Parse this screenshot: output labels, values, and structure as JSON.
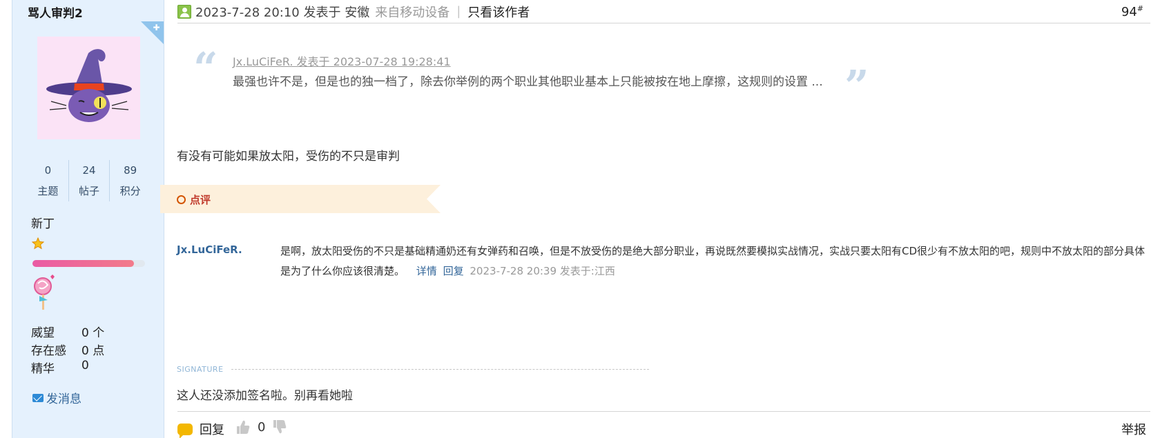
{
  "author": {
    "name": "骂人审判2",
    "stats": [
      {
        "value": "0",
        "label": "主题"
      },
      {
        "value": "24",
        "label": "帖子"
      },
      {
        "value": "89",
        "label": "积分"
      }
    ],
    "rank": "新丁",
    "rank_progress_percent": 90,
    "info": [
      {
        "label": "威望",
        "value": "0 个"
      },
      {
        "label": "存在感",
        "value": "0 点"
      },
      {
        "label": "精华",
        "value": "0"
      }
    ],
    "send_message": "发消息"
  },
  "post": {
    "time": "2023-7-28 20:10 发表于 安徽",
    "from": "来自移动设备",
    "separator": "|",
    "only_author": "只看该作者",
    "floor_number": "94",
    "floor_suffix": "#"
  },
  "quote": {
    "author_line": "Jx.LuCiFeR. 发表于 2023-07-28 19:28:41",
    "text": "最强也许不是，但是也的独一档了，除去你举例的两个职业其他职业基本上只能被按在地上摩擦，这规则的设置 ...",
    "open_mark": "“",
    "close_mark": "”"
  },
  "message": "有没有可能如果放太阳，受伤的不只是审判",
  "comments": {
    "section_label": "点评",
    "items": [
      {
        "user": "Jx.LuCiFeR.",
        "text": "是啊，放太阳受伤的不只是基础精通奶还有女弹药和召唤，但是不放受伤的是绝大部分职业，再说既然要模拟实战情况，实战只要太阳有CD很少有不放太阳的吧，规则中不放太阳的部分具体是为了什么你应该很清楚。",
        "detail_link": "详情",
        "reply_link": "回复",
        "time": "2023-7-28 20:39 发表于:江西"
      }
    ]
  },
  "signature": {
    "label": "SIGNATURE",
    "text": "这人还没添加签名啦。别再看她啦"
  },
  "footer": {
    "reply": "回复",
    "like_count": "0",
    "report": "举报"
  },
  "colors": {
    "sidebar_bg": "#e5f1fd",
    "link": "#336699",
    "ribbon": "#fdf0dc",
    "accent_red": "#c0392b"
  }
}
